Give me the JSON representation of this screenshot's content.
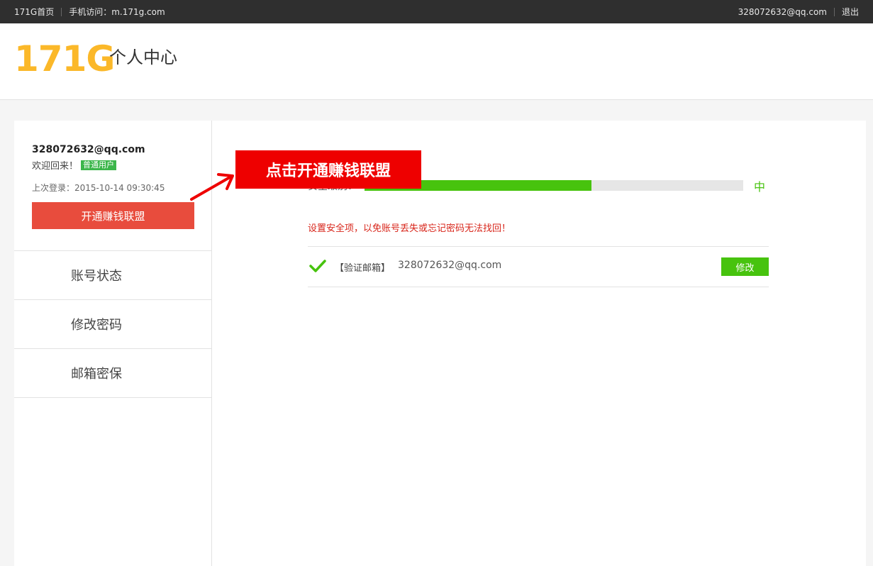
{
  "topbar": {
    "home_link": "171G首页",
    "mobile_link": "手机访问：m.171g.com",
    "user_email": "328072632@qq.com",
    "logout": "退出"
  },
  "header": {
    "logo": "171G",
    "title": "个人中心"
  },
  "sidebar": {
    "user_email": "328072632@qq.com",
    "welcome": "欢迎回来！",
    "user_badge": "普通用户",
    "last_login": "上次登录：2015-10-14 09:30:45",
    "join_button": "开通赚钱联盟",
    "nav": [
      {
        "label": "账号状态"
      },
      {
        "label": "修改密码"
      },
      {
        "label": "邮箱密保"
      }
    ]
  },
  "main": {
    "security_label": "安全级别：",
    "security_progress_percent": 60,
    "security_level": "中",
    "warning": "设置安全项，以免账号丢失或忘记密码无法找回！",
    "email_row": {
      "label": "【验证邮箱】",
      "value": "328072632@qq.com",
      "edit_button": "修改",
      "status_icon": "check-icon"
    }
  },
  "callout": {
    "text": "点击开通赚钱联盟"
  },
  "colors": {
    "accent_green": "#47c30e",
    "join_red": "#e84c3d",
    "callout_red": "#ee0000",
    "logo_yellow": "#fbb829",
    "warning_red": "#d8261b"
  }
}
